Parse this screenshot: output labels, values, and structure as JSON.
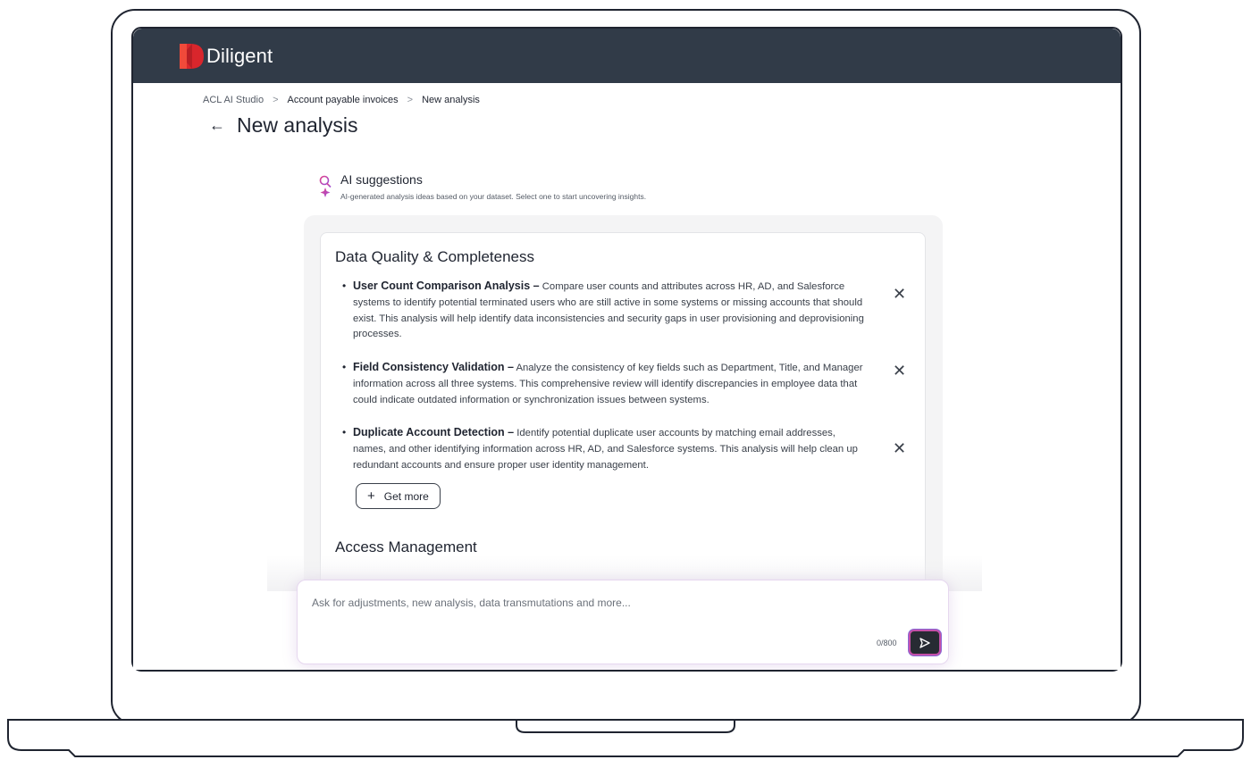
{
  "brand": {
    "name": "Diligent",
    "accent": "#d9262c",
    "topbar_color": "#313b48"
  },
  "breadcrumb": {
    "items": [
      "ACL AI Studio",
      "Account payable invoices",
      "New analysis"
    ],
    "separator": ">"
  },
  "page": {
    "back_icon": "arrow-left-icon",
    "title": "New analysis"
  },
  "ai_suggestions": {
    "icon": "ai-search-sparkle-icon",
    "title": "AI suggestions",
    "subtitle": "AI-generated analysis ideas based on your dataset. Select one to start uncovering insights."
  },
  "sections": [
    {
      "title": "Data Quality & Completeness",
      "items": [
        {
          "title": "User Count Comparison Analysis –",
          "description": "Compare user counts and attributes across HR, AD, and Salesforce systems to identify potential terminated users who are still active in some systems or missing accounts that should exist. This analysis will help identify data inconsistencies and security gaps in user provisioning and deprovisioning processes."
        },
        {
          "title": "Field Consistency Validation –",
          "description": "Analyze the consistency of key fields such as Department, Title, and Manager information across all three systems. This comprehensive review will identify discrepancies in employee data that could indicate outdated information or synchronization issues between systems."
        },
        {
          "title": "Duplicate Account Detection –",
          "description": "Identify potential duplicate user accounts by matching email addresses, names, and other identifying information across HR, AD, and Salesforce systems. This analysis will help clean up redundant accounts and ensure proper user identity management."
        }
      ],
      "get_more_label": "Get more"
    },
    {
      "title": "Access Management",
      "items": []
    }
  ],
  "chat": {
    "placeholder": "Ask for adjustments, new analysis, data transmutations and more...",
    "value": "",
    "counter": "0/800",
    "send_icon": "send-icon"
  },
  "close_glyph": "✕"
}
